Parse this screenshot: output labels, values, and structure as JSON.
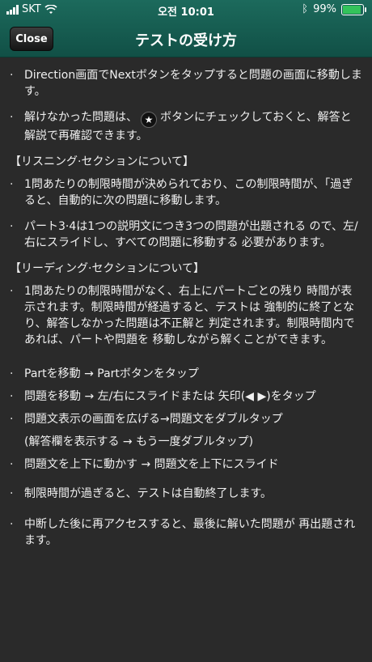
{
  "status_bar": {
    "carrier": "SKT",
    "time": "오전 10:01",
    "battery": "99%",
    "icons": [
      "signal-icon",
      "wifi-icon",
      "bluetooth-icon",
      "battery-icon"
    ]
  },
  "header": {
    "close_label": "Close",
    "title": "テストの受け方"
  },
  "content": {
    "item1": "Direction画面でNextボタンをタップすると問題の画面に移動します。",
    "item2_pre": "解けなかった問題は、",
    "item2_post": "ボタンにチェックしておくと、解答と解説で再確認できます。",
    "listening_title": "【リスニング·セクションについて】",
    "listening_1": "1問あたりの制限時間が決められており、この制限時間が、｢過ぎると、自動的に次の問題に移動します。",
    "listening_2": "パート3·4は1つの説明文につき3つの問題が出題される ので、左/右にスライドし、すべての問題に移動する 必要があります。",
    "reading_title": "【リーディング·セクションについて】",
    "reading_1": "1問あたりの制限時間がなく、右上にパートごとの残り 時間が表示されます。制限時間が経過すると、テストは 強制的に終了となり、解答しなかった問題は不正解と 判定されます。制限時間内であれば、パートや問題を 移動しながら解くことができます。",
    "tip_1": "Partを移動 → Partボタンをタップ",
    "tip_2": "問題を移動 → 左/右にスライドまたは 矢印(◀ ▶)をタップ",
    "tip_3": "問題文表示の画面を広げる→問題文をダブルタップ",
    "tip_3_sub": "(解答欄を表示する → もう一度ダブルタップ)",
    "tip_4": "問題文を上下に動かす → 問題文を上下にスライド",
    "item_end_1": "制限時間が過ぎると、テストは自動終了します。",
    "item_end_2": "中断した後に再アクセスすると、最後に解いた問題が 再出題されます。"
  },
  "bullet": "·",
  "colors": {
    "header": "#1c6a5c",
    "background": "#2a2a2a",
    "text": "#f0f0f0"
  }
}
